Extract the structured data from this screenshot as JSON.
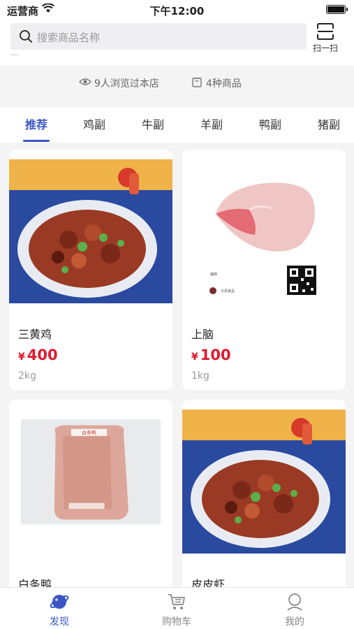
{
  "status_bar": {
    "carrier": "运营商",
    "time": "下午12:00"
  },
  "search": {
    "placeholder": "搜索商品名称",
    "scan_label": "扫一扫"
  },
  "store_stats": {
    "views": "9人浏览过本店",
    "goods": "4种商品"
  },
  "tabs": [
    {
      "label": "推荐",
      "active": true
    },
    {
      "label": "鸡副"
    },
    {
      "label": "牛副"
    },
    {
      "label": "羊副"
    },
    {
      "label": "鸭副"
    },
    {
      "label": "猪副"
    }
  ],
  "products": [
    {
      "name": "三黄鸡",
      "currency": "¥",
      "price": "400",
      "weight": "2kg"
    },
    {
      "name": "上脑",
      "currency": "¥",
      "price": "100",
      "weight": "1kg",
      "image_text": {
        "brand": "猪蹄",
        "shop": "元源食品"
      }
    },
    {
      "name": "白条鸭",
      "image_text": {
        "label": "白条鸭"
      }
    },
    {
      "name": "皮皮虾"
    }
  ],
  "bottom_nav": [
    {
      "label": "发现",
      "icon": "planet-icon",
      "active": true
    },
    {
      "label": "购物车",
      "icon": "cart-icon"
    },
    {
      "label": "我的",
      "icon": "user-icon"
    }
  ],
  "colors": {
    "accent": "#3b55c4",
    "price": "#e0192f",
    "background": "#f4f4f5"
  }
}
